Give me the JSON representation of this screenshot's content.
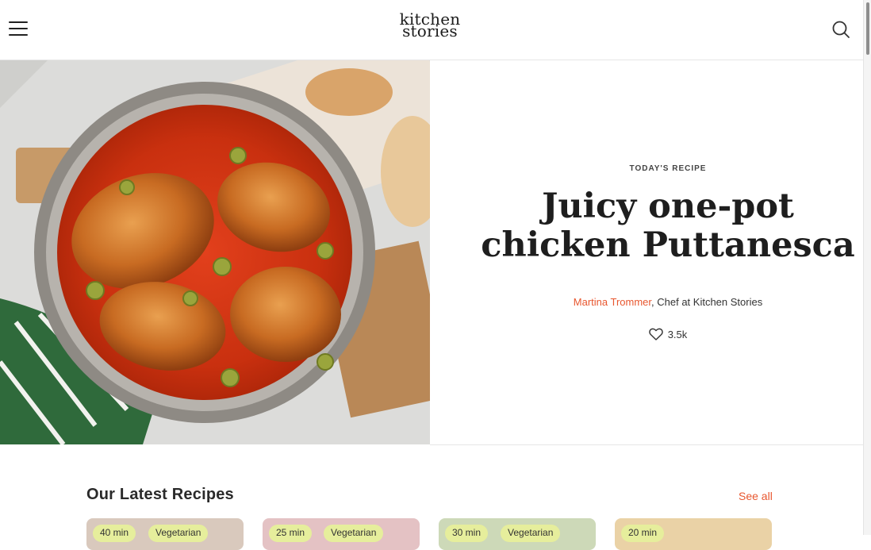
{
  "header": {
    "logo_line1": "kitchen",
    "logo_line2": "stories"
  },
  "hero": {
    "eyebrow": "TODAY'S RECIPE",
    "title_line1": "Juicy one-pot",
    "title_line2": "chicken Puttanesca",
    "author": "Martina Trommer",
    "author_role": ", Chef at Kitchen Stories",
    "likes": "3.5k"
  },
  "latest": {
    "title": "Our Latest Recipes",
    "see_all": "See all",
    "cards": [
      {
        "time": "40 min",
        "tag": "Vegetarian",
        "bg": "#d9c9bd"
      },
      {
        "time": "25 min",
        "tag": "Vegetarian",
        "bg": "#e4c2c4"
      },
      {
        "time": "30 min",
        "tag": "Vegetarian",
        "bg": "#cdd9b8"
      },
      {
        "time": "20 min",
        "tag": "",
        "bg": "#ead2a6"
      }
    ]
  },
  "colors": {
    "accent": "#e8572f",
    "tag_bg": "#e6ee9c"
  },
  "icons": {
    "menu": "hamburger-menu-icon",
    "search": "search-icon",
    "like": "heart-icon"
  }
}
